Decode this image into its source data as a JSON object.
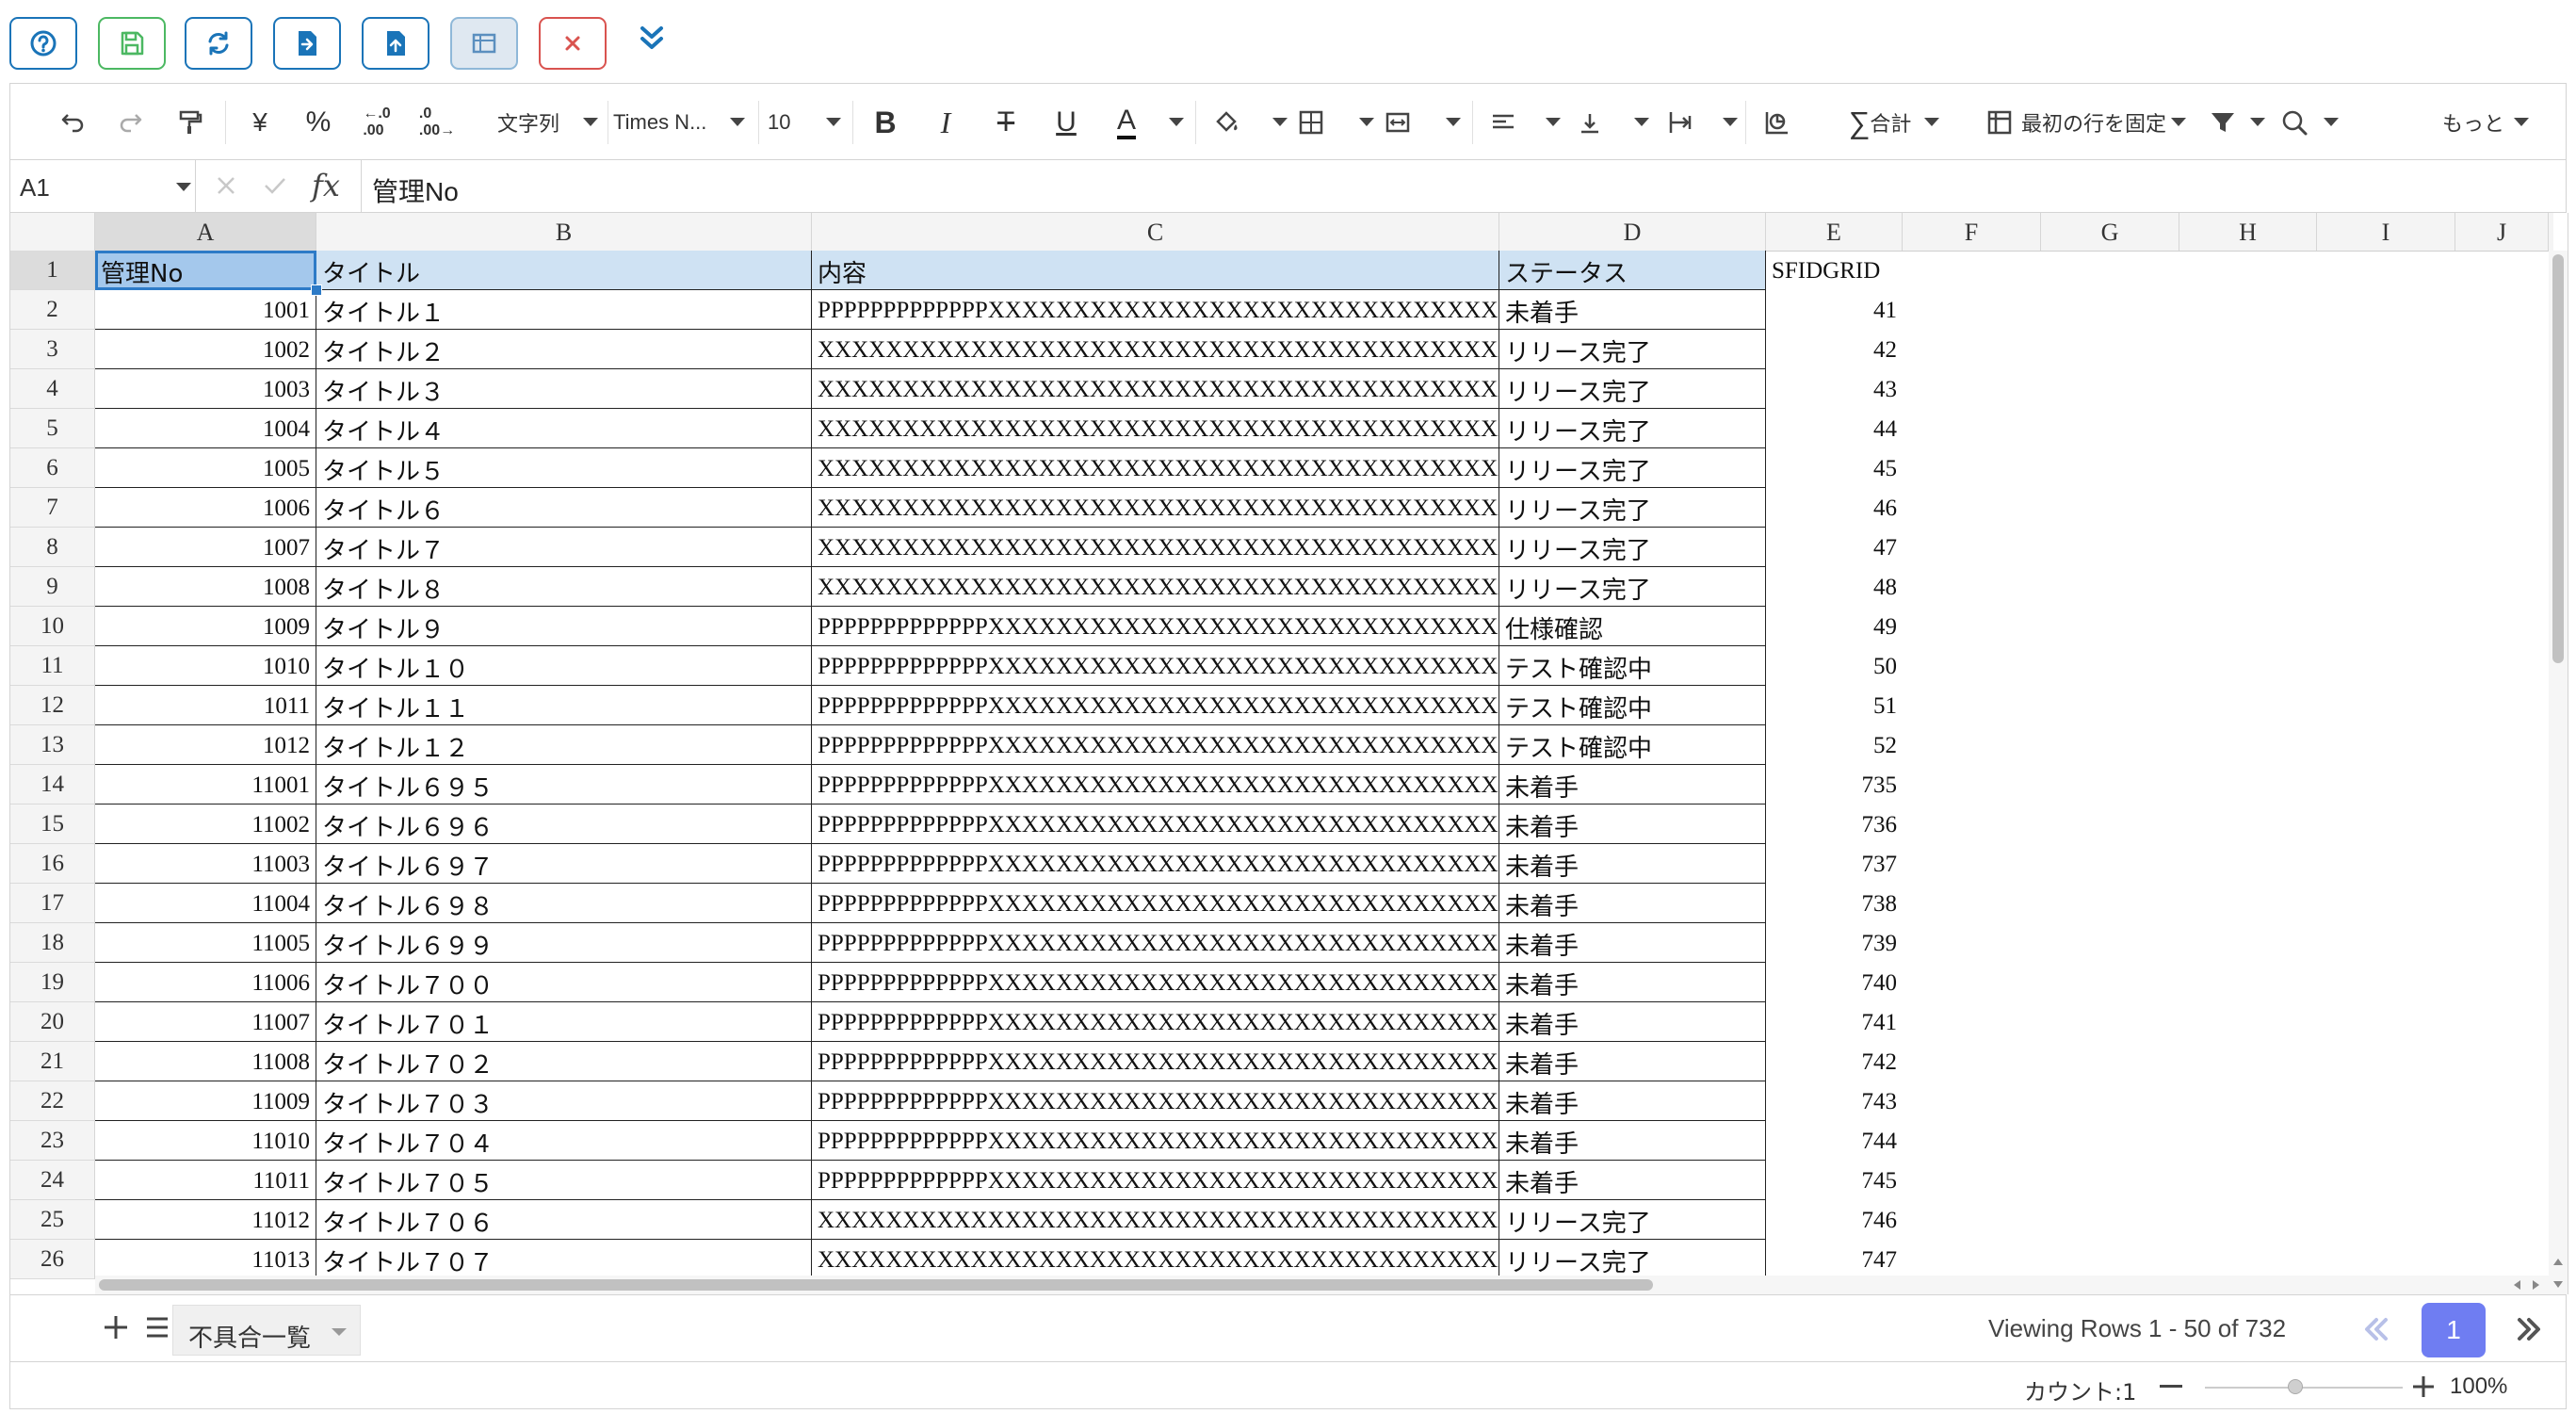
{
  "toolbar_buttons": [
    {
      "name": "help-button",
      "icon": "help-icon"
    },
    {
      "name": "save-button",
      "icon": "save-icon"
    },
    {
      "name": "refresh-button",
      "icon": "refresh-icon"
    },
    {
      "name": "export-button",
      "icon": "export-icon"
    },
    {
      "name": "import-button",
      "icon": "import-icon"
    },
    {
      "name": "layout-button",
      "icon": "layout-icon"
    },
    {
      "name": "close-button",
      "icon": "close-icon"
    }
  ],
  "ribbon": {
    "font_type_label": "文字列",
    "font_name": "Times N...",
    "font_size": "10",
    "sum_label": "合計",
    "freeze_label": "最初の行を固定",
    "more_label": "もっと"
  },
  "formula_bar": {
    "cell_ref": "A1",
    "fx": "fx",
    "value": "管理No"
  },
  "columns": [
    "A",
    "B",
    "C",
    "D",
    "E",
    "F",
    "G",
    "H",
    "I",
    "J"
  ],
  "header": {
    "a": "管理No",
    "b": "タイトル",
    "c": "内容",
    "d": "ステータス",
    "e": "SFIDGRID"
  },
  "rows": [
    {
      "r": "2",
      "a": "1001",
      "b": "タイトル１",
      "c": "PPPPPPPPPPPPPXXXXXXXXXXXXXXXXXXXXXXXXXXXXXXX",
      "d": "未着手",
      "e": "41"
    },
    {
      "r": "3",
      "a": "1002",
      "b": "タイトル２",
      "c": "XXXXXXXXXXXXXXXXXXXXXXXXXXXXXXXXXXXXXXXXXXXXXXX",
      "d": "リリース完了",
      "e": "42"
    },
    {
      "r": "4",
      "a": "1003",
      "b": "タイトル３",
      "c": "XXXXXXXXXXXXXXXXXXXXXXXXXXXXXXXXXXXXXXXXXXXXXXX",
      "d": "リリース完了",
      "e": "43"
    },
    {
      "r": "5",
      "a": "1004",
      "b": "タイトル４",
      "c": "XXXXXXXXXXXXXXXXXXXXXXXXXXXXXXXXXXXXXXXXXXXXXXX",
      "d": "リリース完了",
      "e": "44"
    },
    {
      "r": "6",
      "a": "1005",
      "b": "タイトル５",
      "c": "XXXXXXXXXXXXXXXXXXXXXXXXXXXXXXXXXXXXXXXXXXXXXXX",
      "d": "リリース完了",
      "e": "45"
    },
    {
      "r": "7",
      "a": "1006",
      "b": "タイトル６",
      "c": "XXXXXXXXXXXXXXXXXXXXXXXXXXXXXXXXXXXXXXXXXXXXXXX",
      "d": "リリース完了",
      "e": "46"
    },
    {
      "r": "8",
      "a": "1007",
      "b": "タイトル７",
      "c": "XXXXXXXXXXXXXXXXXXXXXXXXXXXXXXXXXXXXXXXXXXXXXXX",
      "d": "リリース完了",
      "e": "47"
    },
    {
      "r": "9",
      "a": "1008",
      "b": "タイトル８",
      "c": "XXXXXXXXXXXXXXXXXXXXXXXXXXXXXXXXXXXXXXXXXXXXXXX",
      "d": "リリース完了",
      "e": "48"
    },
    {
      "r": "10",
      "a": "1009",
      "b": "タイトル９",
      "c": "PPPPPPPPPPPPPXXXXXXXXXXXXXXXXXXXXXXXXXXXXXXX",
      "d": "仕様確認",
      "e": "49"
    },
    {
      "r": "11",
      "a": "1010",
      "b": "タイトル１０",
      "c": "PPPPPPPPPPPPPXXXXXXXXXXXXXXXXXXXXXXXXXXXXXXX",
      "d": "テスト確認中",
      "e": "50"
    },
    {
      "r": "12",
      "a": "1011",
      "b": "タイトル１１",
      "c": "PPPPPPPPPPPPPXXXXXXXXXXXXXXXXXXXXXXXXXXXXXXX",
      "d": "テスト確認中",
      "e": "51"
    },
    {
      "r": "13",
      "a": "1012",
      "b": "タイトル１２",
      "c": "PPPPPPPPPPPPPXXXXXXXXXXXXXXXXXXXXXXXXXXXXXXX",
      "d": "テスト確認中",
      "e": "52"
    },
    {
      "r": "14",
      "a": "11001",
      "b": "タイトル６９５",
      "c": "PPPPPPPPPPPPPXXXXXXXXXXXXXXXXXXXXXXXXXXXXXXX",
      "d": "未着手",
      "e": "735"
    },
    {
      "r": "15",
      "a": "11002",
      "b": "タイトル６９６",
      "c": "PPPPPPPPPPPPPXXXXXXXXXXXXXXXXXXXXXXXXXXXXXXX",
      "d": "未着手",
      "e": "736"
    },
    {
      "r": "16",
      "a": "11003",
      "b": "タイトル６９７",
      "c": "PPPPPPPPPPPPPXXXXXXXXXXXXXXXXXXXXXXXXXXXXXXX",
      "d": "未着手",
      "e": "737"
    },
    {
      "r": "17",
      "a": "11004",
      "b": "タイトル６９８",
      "c": "PPPPPPPPPPPPPXXXXXXXXXXXXXXXXXXXXXXXXXXXXXXX",
      "d": "未着手",
      "e": "738"
    },
    {
      "r": "18",
      "a": "11005",
      "b": "タイトル６９９",
      "c": "PPPPPPPPPPPPPXXXXXXXXXXXXXXXXXXXXXXXXXXXXXXX",
      "d": "未着手",
      "e": "739"
    },
    {
      "r": "19",
      "a": "11006",
      "b": "タイトル７００",
      "c": "PPPPPPPPPPPPPXXXXXXXXXXXXXXXXXXXXXXXXXXXXXXX",
      "d": "未着手",
      "e": "740"
    },
    {
      "r": "20",
      "a": "11007",
      "b": "タイトル７０１",
      "c": "PPPPPPPPPPPPPXXXXXXXXXXXXXXXXXXXXXXXXXXXXXXX",
      "d": "未着手",
      "e": "741"
    },
    {
      "r": "21",
      "a": "11008",
      "b": "タイトル７０２",
      "c": "PPPPPPPPPPPPPXXXXXXXXXXXXXXXXXXXXXXXXXXXXXXX",
      "d": "未着手",
      "e": "742"
    },
    {
      "r": "22",
      "a": "11009",
      "b": "タイトル７０３",
      "c": "PPPPPPPPPPPPPXXXXXXXXXXXXXXXXXXXXXXXXXXXXXXX",
      "d": "未着手",
      "e": "743"
    },
    {
      "r": "23",
      "a": "11010",
      "b": "タイトル７０４",
      "c": "PPPPPPPPPPPPPXXXXXXXXXXXXXXXXXXXXXXXXXXXXXXX",
      "d": "未着手",
      "e": "744"
    },
    {
      "r": "24",
      "a": "11011",
      "b": "タイトル７０５",
      "c": "PPPPPPPPPPPPPXXXXXXXXXXXXXXXXXXXXXXXXXXXXXXX",
      "d": "未着手",
      "e": "745"
    },
    {
      "r": "25",
      "a": "11012",
      "b": "タイトル７０６",
      "c": "XXXXXXXXXXXXXXXXXXXXXXXXXXXXXXXXXXXXXXXXXXXXXXX",
      "d": "リリース完了",
      "e": "746"
    },
    {
      "r": "26",
      "a": "11013",
      "b": "タイトル７０７",
      "c": "XXXXXXXXXXXXXXXXXXXXXXXXXXXXXXXXXXXXXXXXXXXXXXX",
      "d": "リリース完了",
      "e": "747"
    }
  ],
  "sheet_tab": {
    "label": "不具合一覧"
  },
  "pager": {
    "viewing": "Viewing Rows 1 - 50 of 732",
    "current_page": "1"
  },
  "status": {
    "count": "カウント:1",
    "zoom": "100%"
  },
  "colors": {
    "accent": "#1a74b8",
    "save": "#4cb862",
    "close": "#d9534f",
    "pager_active": "#6f7df2",
    "header_fill": "#cfe2f3",
    "selection": "#a4c8ec"
  }
}
